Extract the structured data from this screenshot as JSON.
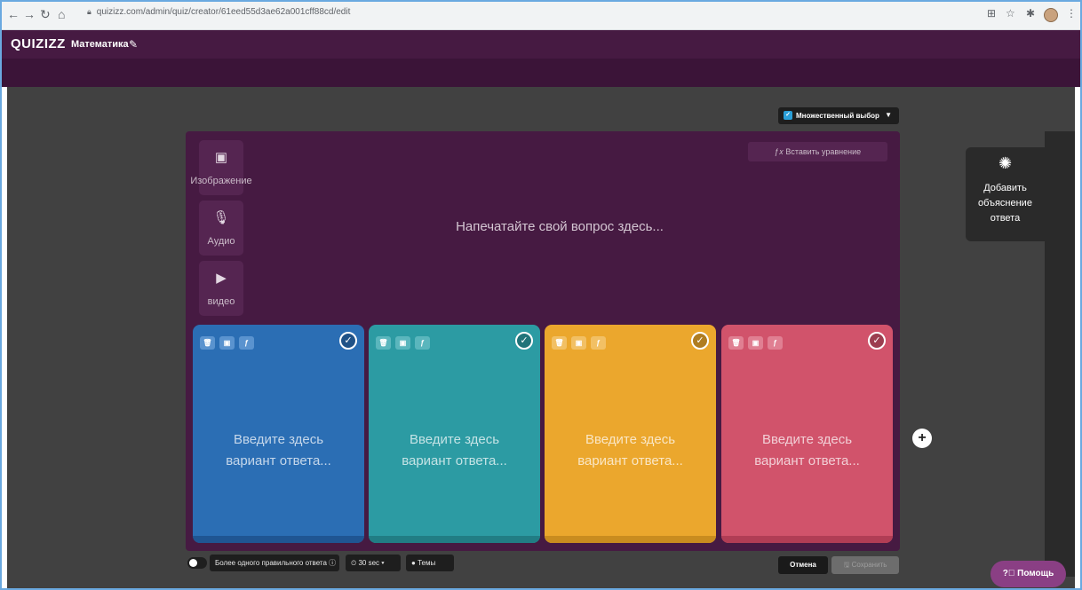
{
  "browser": {
    "url": "quizizz.com/admin/quiz/creator/61eed55d3ae62a001cff88cd/edit",
    "lock_icon": "lock-icon"
  },
  "header": {
    "logo": "QUIZIZZ",
    "quiz_title": "Математика"
  },
  "question_type": {
    "label": "Множественный выбор"
  },
  "media": {
    "image_label": "Изображение",
    "audio_label": "Аудио",
    "video_label": "видео"
  },
  "equation_button": "Вставить уравнение",
  "question_placeholder": "Напечатайте свой вопрос здесь...",
  "answers": [
    {
      "placeholder_line1": "Введите здесь",
      "placeholder_line2": "вариант ответа...",
      "color": "#2b6eb4"
    },
    {
      "placeholder_line1": "Введите здесь",
      "placeholder_line2": "вариант ответа...",
      "color": "#2c9ba3"
    },
    {
      "placeholder_line1": "Введите здесь",
      "placeholder_line2": "вариант ответа...",
      "color": "#eba72d"
    },
    {
      "placeholder_line1": "Введите здесь",
      "placeholder_line2": "вариант ответа...",
      "color": "#d1536b"
    }
  ],
  "explanation": {
    "line1": "Добавить",
    "line2": "объяснение",
    "line3": "ответа"
  },
  "footer": {
    "multi_correct_label": "Более одного правильного ответа",
    "time_label": "30 sec",
    "topics_label": "Темы",
    "cancel_label": "Отмена",
    "save_label": "Сохранить"
  },
  "help_label": "Помощь",
  "colors": {
    "header": "#461a42",
    "workspace": "#414141",
    "editor": "#461a42",
    "help": "#8a3f84"
  }
}
